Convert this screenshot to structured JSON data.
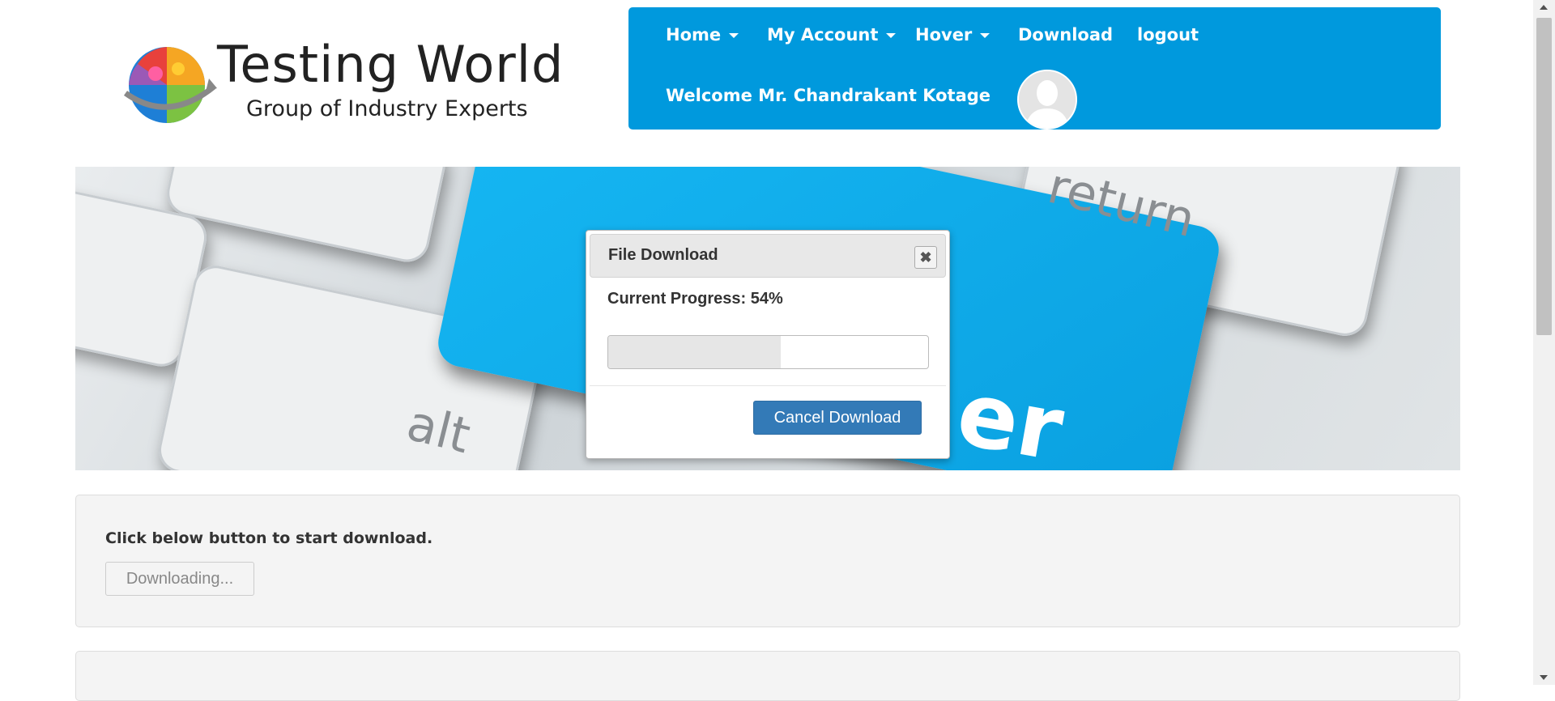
{
  "logo": {
    "title": "Testing World",
    "subtitle": "Group of Industry Experts"
  },
  "nav": {
    "items": [
      {
        "label": "Home",
        "has_dropdown": true
      },
      {
        "label": "My Account",
        "has_dropdown": true
      },
      {
        "label": "Hover",
        "has_dropdown": true
      },
      {
        "label": "Download",
        "has_dropdown": false
      },
      {
        "label": "logout",
        "has_dropdown": false
      }
    ],
    "welcome": "Welcome Mr. Chandrakant Kotage",
    "background_color": "#0099dd"
  },
  "banner": {
    "key_labels": [
      "return",
      "alt",
      "er"
    ]
  },
  "dialog": {
    "title": "File Download",
    "close_icon": "close-icon",
    "progress_label": "Current Progress: 54%",
    "progress_value": 0.54,
    "cancel_label": "Cancel Download",
    "cancel_color": "#337ab7"
  },
  "main": {
    "instruction": "Click below button to start download.",
    "download_button_label": "Downloading..."
  }
}
